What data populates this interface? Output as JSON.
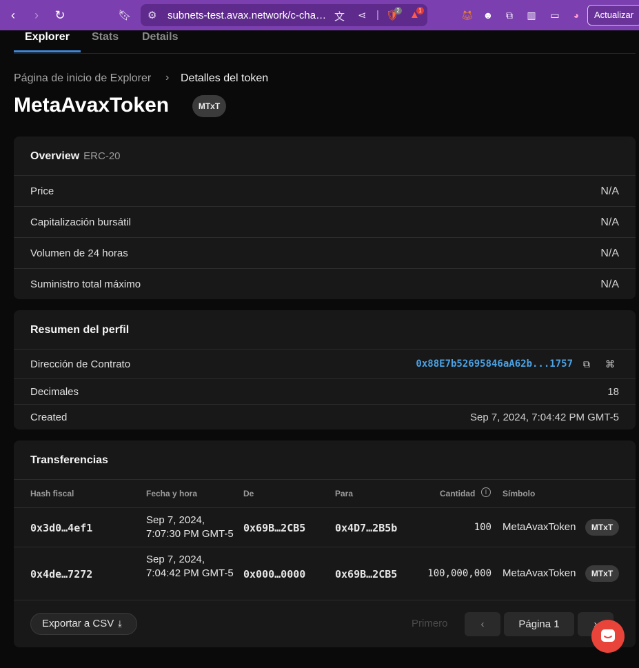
{
  "browser": {
    "url": "subnets-test.avax.network/c-cha…",
    "update_label": "Actualizar",
    "brave_badge": "2",
    "alert_badge": "1"
  },
  "tabs": [
    {
      "label": "Explorer",
      "active": true
    },
    {
      "label": "Stats",
      "active": false
    },
    {
      "label": "Details",
      "active": false
    }
  ],
  "breadcrumb": {
    "home": "Página de inicio de Explorer",
    "current": "Detalles del token"
  },
  "token": {
    "name": "MetaAvaxToken",
    "symbol": "MTxT"
  },
  "overview": {
    "title": "Overview",
    "standard": "ERC-20",
    "rows": [
      {
        "label": "Price",
        "value": "N/A"
      },
      {
        "label": "Capitalización bursátil",
        "value": "N/A"
      },
      {
        "label": "Volumen de 24 horas",
        "value": "N/A"
      },
      {
        "label": "Suministro total máximo",
        "value": "N/A"
      }
    ]
  },
  "profile": {
    "title": "Resumen del perfil",
    "contract_label": "Dirección de Contrato",
    "contract_value": "0x88E7b52695846aA62b...1757",
    "decimals_label": "Decimales",
    "decimals_value": "18",
    "created_label": "Created",
    "created_value": "Sep 7, 2024, 7:04:42 PM GMT-5"
  },
  "transfers": {
    "title": "Transferencias",
    "columns": [
      "Hash fiscal",
      "Fecha y hora",
      "De",
      "Para",
      "Cantidad",
      "Símbolo"
    ],
    "rows": [
      {
        "hash": "0x3d0…4ef1",
        "date": "Sep 7, 2024, 7:07:30 PM GMT-5",
        "from": "0x69B…2CB5",
        "to": "0x4D7…2B5b",
        "amount": "100",
        "symbol_name": "MetaAvaxToken",
        "symbol": "MTxT"
      },
      {
        "hash": "0x4de…7272",
        "date": "Sep 7, 2024, 7:04:42 PM GMT-5",
        "from": "0x000…0000",
        "to": "0x69B…2CB5",
        "amount": "100,000,000",
        "symbol_name": "MetaAvaxToken",
        "symbol": "MTxT"
      }
    ],
    "export_label": "Exportar a CSV",
    "first_label": "Primero",
    "page_label": "Página 1"
  },
  "colors": {
    "toolbar": "#7b3fb0",
    "accent": "#3f88d9",
    "link": "#4aa3e6",
    "chat": "#e8443a"
  }
}
